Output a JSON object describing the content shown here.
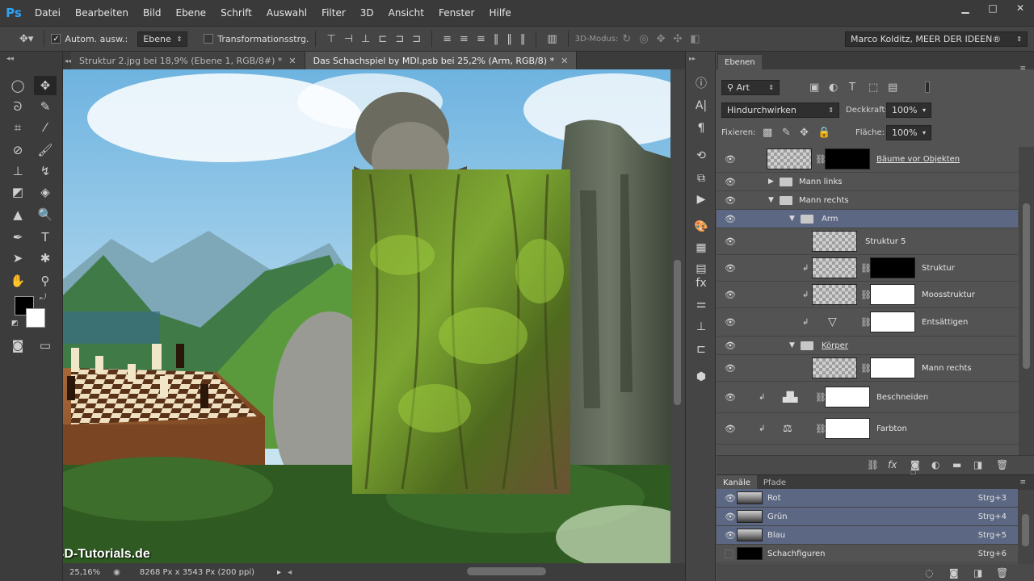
{
  "app": {
    "logo": "Ps"
  },
  "menu": [
    "Datei",
    "Bearbeiten",
    "Bild",
    "Ebene",
    "Schrift",
    "Auswahl",
    "Filter",
    "3D",
    "Ansicht",
    "Fenster",
    "Hilfe"
  ],
  "window_controls": {
    "minimize": "▁",
    "maximize": "□",
    "close": "✕"
  },
  "options": {
    "auto_select_label": "Autom. ausw.:",
    "auto_select_value": "Ebene",
    "transform_label": "Transformationsstrg.",
    "mode_3d_label": "3D-Modus:",
    "workspace": "Marco Kolditz, MEER DER IDEEN®"
  },
  "tabs": [
    {
      "label": "Struktur 2.jpg bei 18,9% (Ebene 1, RGB/8#) *",
      "close": "✕"
    },
    {
      "label": "Das Schachspiel by MDI.psb bei 25,2% (Arm, RGB/8) *",
      "close": "✕"
    }
  ],
  "canvas": {
    "watermark": "PSD-Tutorials.de"
  },
  "status": {
    "zoom": "25,16%",
    "doc_info": "8268 Px x 3543 Px (200 ppi)"
  },
  "layers_panel": {
    "tab": "Ebenen",
    "filter_kind": "Art",
    "blend_mode": "Hindurchwirken",
    "opacity_label": "Deckkraft:",
    "opacity_value": "100%",
    "lock_label": "Fixieren:",
    "fill_label": "Fläche:",
    "fill_value": "100%",
    "layers": [
      {
        "name": "Bäume vor Objekten"
      },
      {
        "name": "Mann links"
      },
      {
        "name": "Mann rechts"
      },
      {
        "name": "Arm"
      },
      {
        "name": "Struktur 5"
      },
      {
        "name": "Struktur"
      },
      {
        "name": "Moosstruktur"
      },
      {
        "name": "Entsättigen"
      },
      {
        "name": "Körper"
      },
      {
        "name": "Mann rechts"
      },
      {
        "name": "Beschneiden"
      },
      {
        "name": "Farbton"
      }
    ]
  },
  "channels_panel": {
    "tabs": [
      "Kanäle",
      "Pfade"
    ],
    "channels": [
      {
        "name": "Rot",
        "shortcut": "Strg+3"
      },
      {
        "name": "Grün",
        "shortcut": "Strg+4"
      },
      {
        "name": "Blau",
        "shortcut": "Strg+5"
      },
      {
        "name": "Schachfiguren",
        "shortcut": "Strg+6"
      }
    ]
  },
  "colors": {
    "accent": "#2fa3f6",
    "selection": "#5c6883",
    "panel": "#535353",
    "chrome": "#3a3a3a"
  }
}
